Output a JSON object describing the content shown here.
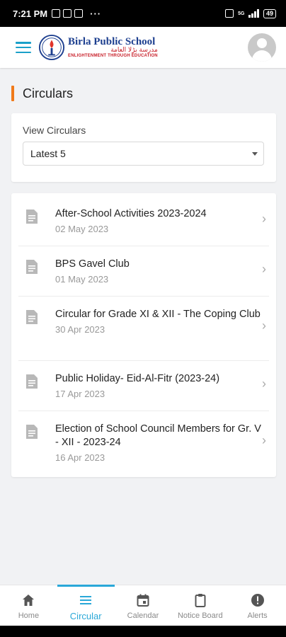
{
  "status_bar": {
    "time": "7:21 PM",
    "network": "5G",
    "battery": "49"
  },
  "header": {
    "school_name": "Birla Public School",
    "school_name_arabic": "مدرسة بڑلا العامة",
    "tagline": "ENLIGHTENMENT THROUGH EDUCATION"
  },
  "page": {
    "title": "Circulars",
    "accent_color": "#f07a1a"
  },
  "filter": {
    "label": "View Circulars",
    "selected": "Latest 5"
  },
  "circulars": [
    {
      "title": "After-School Activities 2023-2024",
      "date": "02 May 2023"
    },
    {
      "title": "BPS Gavel Club",
      "date": "01 May 2023"
    },
    {
      "title": "Circular for Grade XI & XII - The Coping Club",
      "date": "30 Apr 2023"
    },
    {
      "title": "Public Holiday- Eid-Al-Fitr (2023-24)",
      "date": "17 Apr 2023"
    },
    {
      "title": "Election of School Council Members for Gr. V - XII - 2023-24",
      "date": "16 Apr 2023"
    }
  ],
  "nav": {
    "items": [
      {
        "label": "Home",
        "icon": "home-icon"
      },
      {
        "label": "Circular",
        "icon": "menu-icon",
        "active": true
      },
      {
        "label": "Calendar",
        "icon": "calendar-icon"
      },
      {
        "label": "Notice Board",
        "icon": "clipboard-icon"
      },
      {
        "label": "Alerts",
        "icon": "alert-icon"
      }
    ],
    "active_color": "#2aa8d8"
  }
}
